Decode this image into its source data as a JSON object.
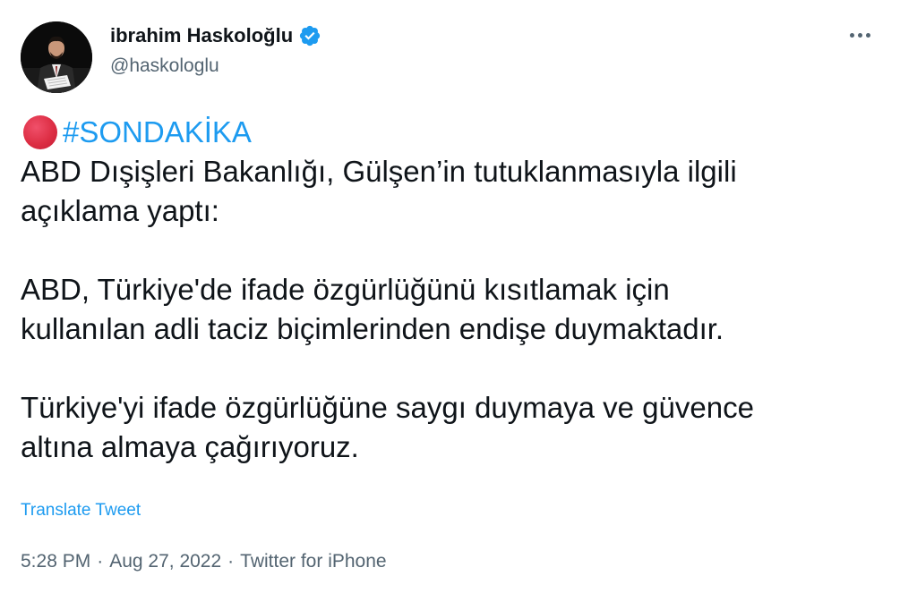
{
  "author": {
    "display_name": "ibrahim Haskoloğlu",
    "handle": "@haskologlu",
    "verified": true
  },
  "icons": {
    "verified": "verified-badge-icon",
    "more": "more-options-icon",
    "emoji": "red-circle-emoji-icon"
  },
  "colors": {
    "link": "#1d9bf0",
    "secondary_text": "#536471",
    "primary_text": "#0f1419",
    "red_circle": "#dd2e44"
  },
  "tweet": {
    "hashtag": "#SONDAKİKA",
    "paragraphs": [
      [
        "ABD Dışişleri Bakanlığı, Gülşen’in tutuklanmasıyla ilgili",
        "açıklama yaptı:"
      ],
      [
        "ABD, Türkiye'de ifade özgürlüğünü kısıtlamak için",
        "kullanılan adli taciz biçimlerinden endişe duymaktadır."
      ],
      [
        "Türkiye'yi ifade özgürlüğüne saygı duymaya ve güvence",
        "altına almaya çağırıyoruz."
      ]
    ],
    "translate_label": "Translate Tweet"
  },
  "meta": {
    "time": "5:28 PM",
    "separator": "·",
    "date": "Aug 27, 2022",
    "source": "Twitter for iPhone"
  }
}
